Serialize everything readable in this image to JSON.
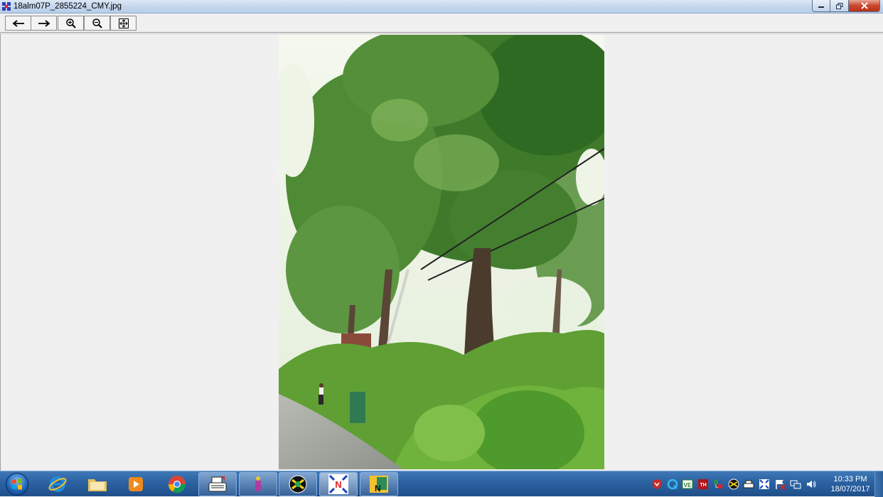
{
  "window": {
    "title": "18alm07P_2855224_CMY.jpg"
  },
  "toolbar": {
    "buttons": [
      {
        "icon": "arrow-left-icon",
        "tooltip": "Previous"
      },
      {
        "icon": "arrow-right-icon",
        "tooltip": "Next"
      },
      {
        "icon": "zoom-in-icon",
        "tooltip": "Zoom in"
      },
      {
        "icon": "zoom-out-icon",
        "tooltip": "Zoom out"
      },
      {
        "icon": "fit-to-window-icon",
        "tooltip": "Fit"
      }
    ]
  },
  "image": {
    "description_icon": "tree-photo"
  },
  "taskbar": {
    "apps": [
      {
        "name": "internet-explorer"
      },
      {
        "name": "file-explorer"
      },
      {
        "name": "media-player"
      },
      {
        "name": "chrome"
      },
      {
        "name": "typewriter-app"
      },
      {
        "name": "pen-app"
      },
      {
        "name": "circle-app"
      },
      {
        "name": "image-viewer",
        "active": true
      },
      {
        "name": "newsroom-app"
      }
    ],
    "clock": {
      "time": "10:33 PM",
      "date": "18/07/2017"
    }
  },
  "colors": {
    "taskbar": "#2d64a3",
    "titlebar": "#c5d7ee",
    "close": "#c9462c"
  }
}
